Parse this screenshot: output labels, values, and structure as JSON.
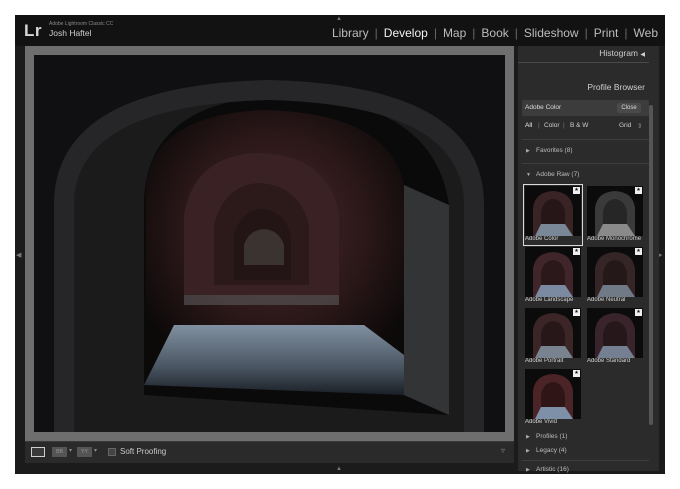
{
  "window": {
    "app_name": "Adobe Lightroom Classic CC",
    "user_name": "Josh Haftel",
    "logo": "Lr"
  },
  "modules": [
    {
      "label": "Library",
      "active": false
    },
    {
      "label": "Develop",
      "active": true
    },
    {
      "label": "Map",
      "active": false
    },
    {
      "label": "Book",
      "active": false
    },
    {
      "label": "Slideshow",
      "active": false
    },
    {
      "label": "Print",
      "active": false
    },
    {
      "label": "Web",
      "active": false
    }
  ],
  "right_panel": {
    "histogram_label": "Histogram",
    "histogram_icon": "triangle-left-icon",
    "profile_browser": {
      "title": "Profile Browser",
      "current_profile": "Adobe Color",
      "close_label": "Close",
      "filters": {
        "all": "All",
        "color": "Color",
        "bw": "B & W",
        "view": "Grid"
      },
      "groups": {
        "favorites": "Favorites (8)",
        "adobe_raw": "Adobe Raw (7)",
        "profiles": "Profiles (1)",
        "legacy": "Legacy (4)",
        "artistic": "Artistic (16)"
      },
      "profiles": [
        {
          "name": "Adobe Color",
          "selected": true,
          "favorite": true
        },
        {
          "name": "Adobe Monochrome",
          "selected": false,
          "favorite": true
        },
        {
          "name": "Adobe Landscape",
          "selected": false,
          "favorite": true
        },
        {
          "name": "Adobe Neutral",
          "selected": false,
          "favorite": true
        },
        {
          "name": "Adobe Portrait",
          "selected": false,
          "favorite": true
        },
        {
          "name": "Adobe Standard",
          "selected": false,
          "favorite": true
        },
        {
          "name": "Adobe Vivid",
          "selected": false,
          "favorite": true
        }
      ]
    }
  },
  "toolbar": {
    "soft_proofing": "Soft Proofing",
    "before_after_label": "BB",
    "yy_label": "YY"
  }
}
